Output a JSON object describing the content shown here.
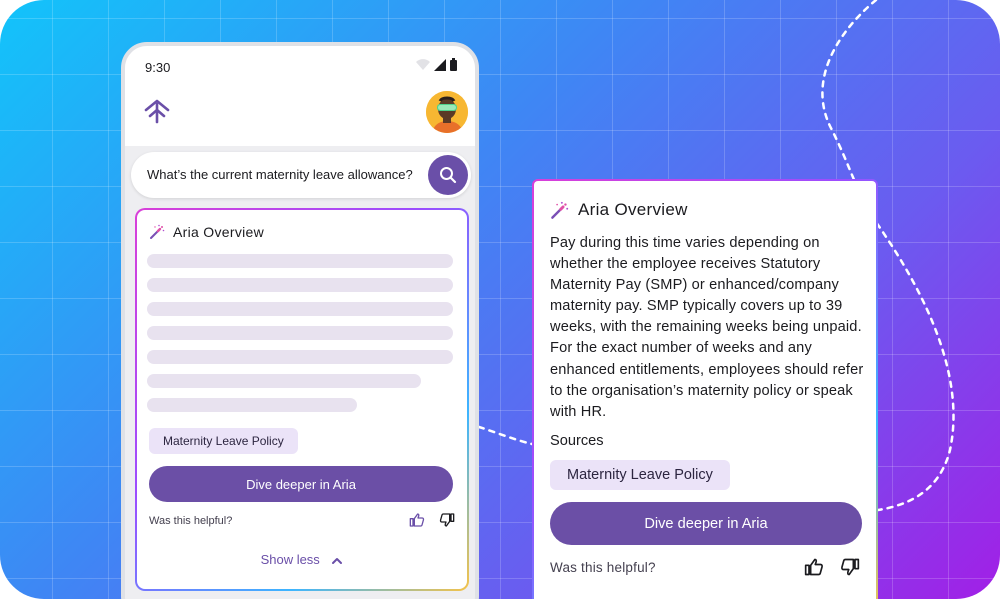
{
  "phone": {
    "status_time": "9:30",
    "search": {
      "query": "What’s the current maternity leave allowance?"
    },
    "overview": {
      "title": "Aria Overview",
      "source_chip": "Maternity Leave Policy",
      "cta": "Dive deeper in Aria",
      "helpful": "Was this helpful?",
      "show_less": "Show less"
    }
  },
  "card": {
    "title": "Aria Overview",
    "body": "Pay during this time varies depending on whether the employee receives Statutory Maternity Pay (SMP) or enhanced/company maternity pay. SMP typically covers up to 39 weeks, with the remaining weeks being unpaid. For the exact number of weeks and any enhanced entitlements, employees should refer to the organisation’s maternity policy or speak with HR.",
    "sources_label": "Sources",
    "source_chip": "Maternity Leave Policy",
    "cta": "Dive deeper in Aria",
    "helpful": "Was this helpful?"
  },
  "icons": {
    "logo": "chevron-up-stack-icon",
    "search": "search-icon",
    "sparkle": "magic-wand-icon",
    "thumb_up": "thumbs-up-icon",
    "thumb_down": "thumbs-down-icon",
    "chevron_up": "chevron-up-icon"
  },
  "colors": {
    "primary": "#6b4fa6",
    "chip": "#ebe3f8",
    "skeleton": "#e8e2ef"
  }
}
